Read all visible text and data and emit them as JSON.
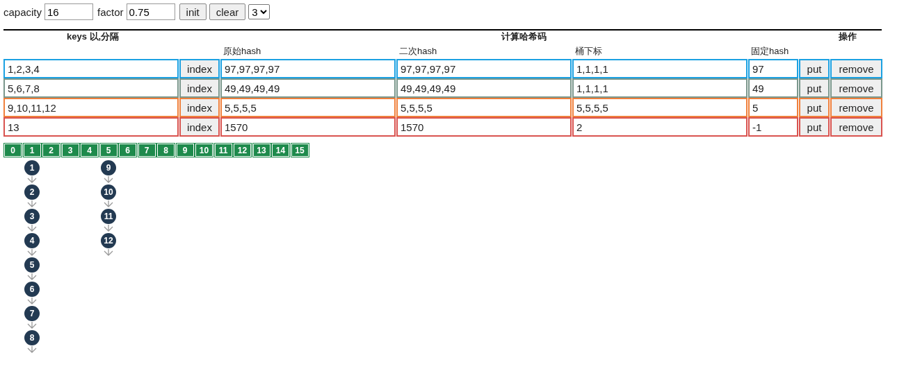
{
  "controls": {
    "capacity_label": "capacity",
    "capacity": "16",
    "factor_label": "factor",
    "factor": "0.75",
    "buttons": [
      "init",
      "clear"
    ],
    "select": "3"
  },
  "table": {
    "headers": [
      "keys 以,分隔",
      "计算哈希码",
      "操作"
    ],
    "subheaders": [
      "原始hash",
      "二次hash",
      "桶下标",
      "固定hash"
    ],
    "rows": [
      {
        "color": "#1ba1e2",
        "keys": "1,2,3,4",
        "index": "index",
        "hash": "97,97,97,97",
        "hash2": "97,97,97,97",
        "bucket": "1,1,1,1",
        "fixed": "97",
        "put": "put",
        "remove": "remove"
      },
      {
        "color": "#7a978c",
        "keys": "5,6,7,8",
        "index": "index",
        "hash": "49,49,49,49",
        "hash2": "49,49,49,49",
        "bucket": "1,1,1,1",
        "fixed": "49",
        "put": "put",
        "remove": "remove"
      },
      {
        "color": "#f0803c",
        "keys": "9,10,11,12",
        "index": "index",
        "hash": "5,5,5,5",
        "hash2": "5,5,5,5",
        "bucket": "5,5,5,5",
        "fixed": "5",
        "put": "put",
        "remove": "remove"
      },
      {
        "color": "#d9534f",
        "keys": "13",
        "index": "index",
        "hash": "1570",
        "hash2": "1570",
        "bucket": "2",
        "fixed": "-1",
        "put": "put",
        "remove": "remove"
      }
    ]
  },
  "buckets": [
    {
      "label": "0"
    },
    {
      "label": "1",
      "nodes": [
        "1",
        "2",
        "3",
        "4",
        "5",
        "6",
        "7",
        "8"
      ]
    },
    {
      "label": "2"
    },
    {
      "label": "3"
    },
    {
      "label": "4"
    },
    {
      "label": "5",
      "nodes": [
        "9",
        "10",
        "11",
        "12"
      ]
    },
    {
      "label": "6"
    },
    {
      "label": "7"
    },
    {
      "label": "8"
    },
    {
      "label": "9"
    },
    {
      "label": "10"
    },
    {
      "label": "11"
    },
    {
      "label": "12"
    },
    {
      "label": "13"
    },
    {
      "label": "14"
    },
    {
      "label": "15"
    }
  ]
}
